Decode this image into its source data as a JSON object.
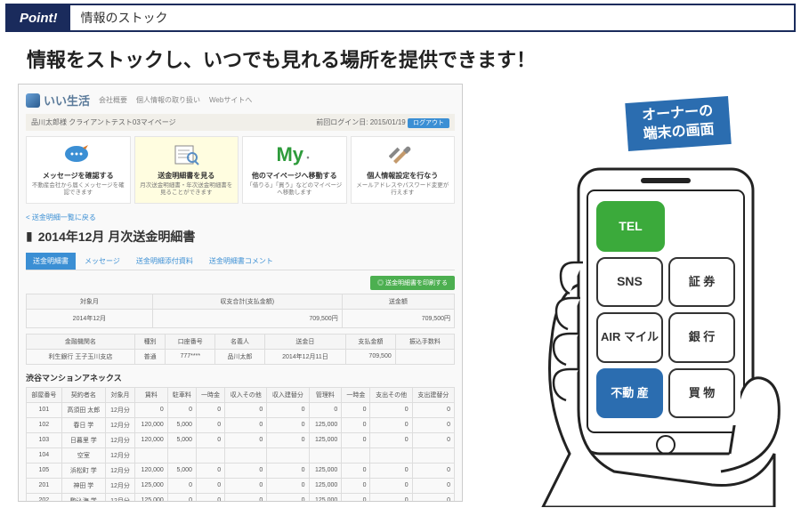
{
  "banner": {
    "badge": "Point!",
    "title": "情報のストック"
  },
  "headline": "情報をストックし、いつでも見れる場所を提供できます！",
  "app": {
    "logo_text": "いい生活",
    "nav": [
      "会社概要",
      "個人情報の取り扱い",
      "Webサイトへ"
    ],
    "user_bar": "品川太郎様 クライアントテスト03マイページ",
    "last_login_label": "前回ログイン日:",
    "last_login": "2015/01/19",
    "logout": "ログアウト"
  },
  "tiles": [
    {
      "title": "メッセージを確認する",
      "desc": "不動産会社から届くメッセージを確認できます",
      "icon": "chat"
    },
    {
      "title": "送金明細書を見る",
      "desc": "月次送金明細書・年次送金明細書を見ることができます",
      "icon": "doc"
    },
    {
      "title": "他のマイページへ移動する",
      "desc": "「借りる」「買う」などのマイページへ移動します",
      "icon": "my"
    },
    {
      "title": "個人情報設定を行なう",
      "desc": "メールアドレスやパスワード変更が行えます",
      "icon": "tools"
    }
  ],
  "crumb": "< 送金明細一覧に戻る",
  "doc_title": "2014年12月 月次送金明細書",
  "tabs": [
    "送金明細書",
    "メッセージ",
    "送金明細添付資料",
    "送金明細書コメント"
  ],
  "green_btn": "◎ 送金明細書を印刷する",
  "summary": {
    "headers": [
      "対象月",
      "収支合計(支払金額)",
      "送金額"
    ],
    "row": [
      "2014年12月",
      "709,500円",
      "709,500円"
    ]
  },
  "bank": {
    "headers": [
      "金融機関名",
      "種別",
      "口座番号",
      "名義人",
      "送金日",
      "支払金額",
      "振込手数料"
    ],
    "row": [
      "利生銀行 王子玉川支店",
      "普通",
      "777****",
      "品川太郎",
      "2014年12月11日",
      "709,500",
      ""
    ]
  },
  "building_name": "渋谷マンションアネックス",
  "detail": {
    "headers": [
      "部屋番号",
      "契約者名",
      "対象月",
      "賃料",
      "駐車料",
      "一時金",
      "収入その他",
      "収入建替分",
      "管理料",
      "一時金",
      "支出その他",
      "支出建替分"
    ],
    "rows": [
      [
        "101",
        "高須田 太郎",
        "12月分",
        "0",
        "0",
        "0",
        "0",
        "0",
        "0",
        "0",
        "0",
        "0"
      ],
      [
        "102",
        "春日 学",
        "12月分",
        "120,000",
        "5,000",
        "0",
        "0",
        "0",
        "125,000",
        "0",
        "0",
        "0"
      ],
      [
        "103",
        "日暮里 学",
        "12月分",
        "120,000",
        "5,000",
        "0",
        "0",
        "0",
        "125,000",
        "0",
        "0",
        "0"
      ],
      [
        "104",
        "空室",
        "12月分",
        "",
        "",
        "",
        "",
        "",
        "",
        "",
        "",
        ""
      ],
      [
        "105",
        "浜松町 学",
        "12月分",
        "120,000",
        "5,000",
        "0",
        "0",
        "0",
        "125,000",
        "0",
        "0",
        "0"
      ],
      [
        "201",
        "神田 学",
        "12月分",
        "125,000",
        "0",
        "0",
        "0",
        "0",
        "125,000",
        "0",
        "0",
        "0"
      ],
      [
        "202",
        "駒込海 学",
        "12月分",
        "125,000",
        "0",
        "0",
        "0",
        "0",
        "125,000",
        "0",
        "0",
        "0"
      ]
    ]
  },
  "phone": {
    "label": "オーナーの\n端末の画面",
    "buttons": {
      "tel": "TEL",
      "sns": "SNS",
      "sec": "証\n券",
      "air": "AIR\nマイル",
      "bank": "銀\n行",
      "re": "不動\n産",
      "shop": "買\n物"
    }
  }
}
